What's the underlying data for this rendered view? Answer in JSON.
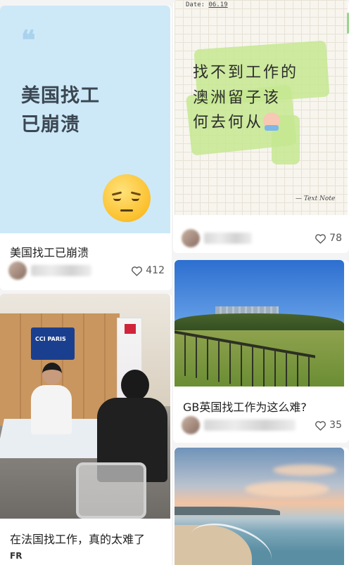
{
  "feed": {
    "left": [
      {
        "cover_title": "美国找工\n已崩溃",
        "quote_mark": "❝",
        "caption": "美国找工已崩溃",
        "likes": "412",
        "cover_color": "#cde9f8"
      },
      {
        "caption": "在法国找工作，真的太难了",
        "banner_text": "CCI PARIS",
        "badge": "FR"
      }
    ],
    "right": [
      {
        "date_label": "Date:",
        "date_value": "06.19",
        "note_text": "找不到工作的\n澳洲留子该\n何去何从",
        "signature": "— Text Note",
        "likes": "78"
      },
      {
        "caption": "GB英国找工作为这么难?",
        "likes": "35"
      },
      {}
    ]
  },
  "colors": {
    "highlight": "#c6e891",
    "cover_blue": "#cde9f8"
  },
  "icons": [
    "quote-icon",
    "sad-face-emoji-icon",
    "crying-emoji-icon",
    "heart-icon"
  ]
}
